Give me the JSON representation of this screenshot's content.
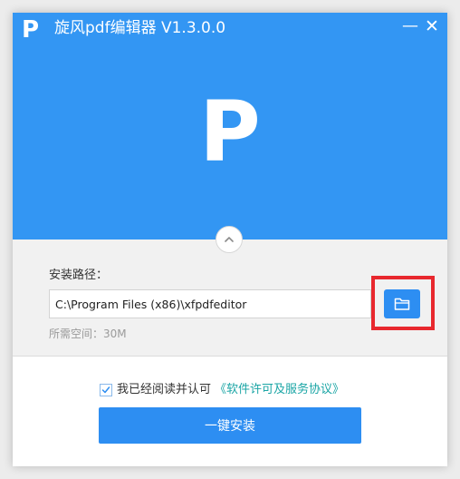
{
  "window": {
    "logo_letter": "P",
    "title": "旋风pdf编辑器 V1.3.0.0",
    "minimize_label": "—",
    "close_label": "✕"
  },
  "hero": {
    "logo_letter": "P"
  },
  "install": {
    "path_label": "安装路径：",
    "path_value": "C:\\Program Files (x86)\\xfpdfeditor",
    "space_required": "所需空间：30M",
    "agree_checked": true,
    "agree_text": "我已经阅读并认可",
    "agreement_link": "《软件许可及服务协议》",
    "install_button": "一键安装"
  },
  "icons": {
    "collapse": "chevron-up-icon",
    "browse": "folder-icon",
    "check": "checkmark-icon"
  },
  "colors": {
    "brand_blue": "#3396f3",
    "button_blue": "#2d8ef2",
    "link_teal": "#1aa5a5",
    "highlight_red": "#e8282e"
  }
}
